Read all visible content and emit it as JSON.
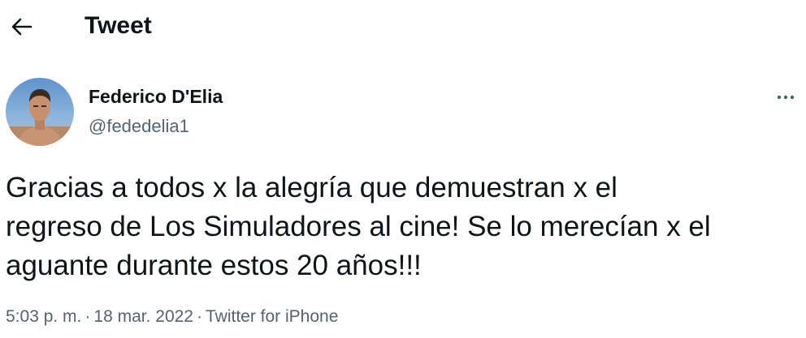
{
  "header": {
    "back_icon": "arrow-left-icon",
    "title": "Tweet"
  },
  "tweet": {
    "author": {
      "avatar_icon": "avatar-photo",
      "name": "Federico D'Elia",
      "handle": "@fededelia1"
    },
    "more_icon": "more-horizontal-icon",
    "text": "Gracias a todos x la alegría que demuestran x el\nregreso de Los Simuladores al cine! Se lo merecían x el\naguante durante estos 20 años!!!",
    "meta": {
      "time": "5:03 p. m.",
      "separator": "·",
      "date": "18 mar. 2022",
      "source": "Twitter for iPhone"
    }
  },
  "colors": {
    "text_primary": "#0f1419",
    "text_secondary": "#536471",
    "background": "#ffffff"
  }
}
